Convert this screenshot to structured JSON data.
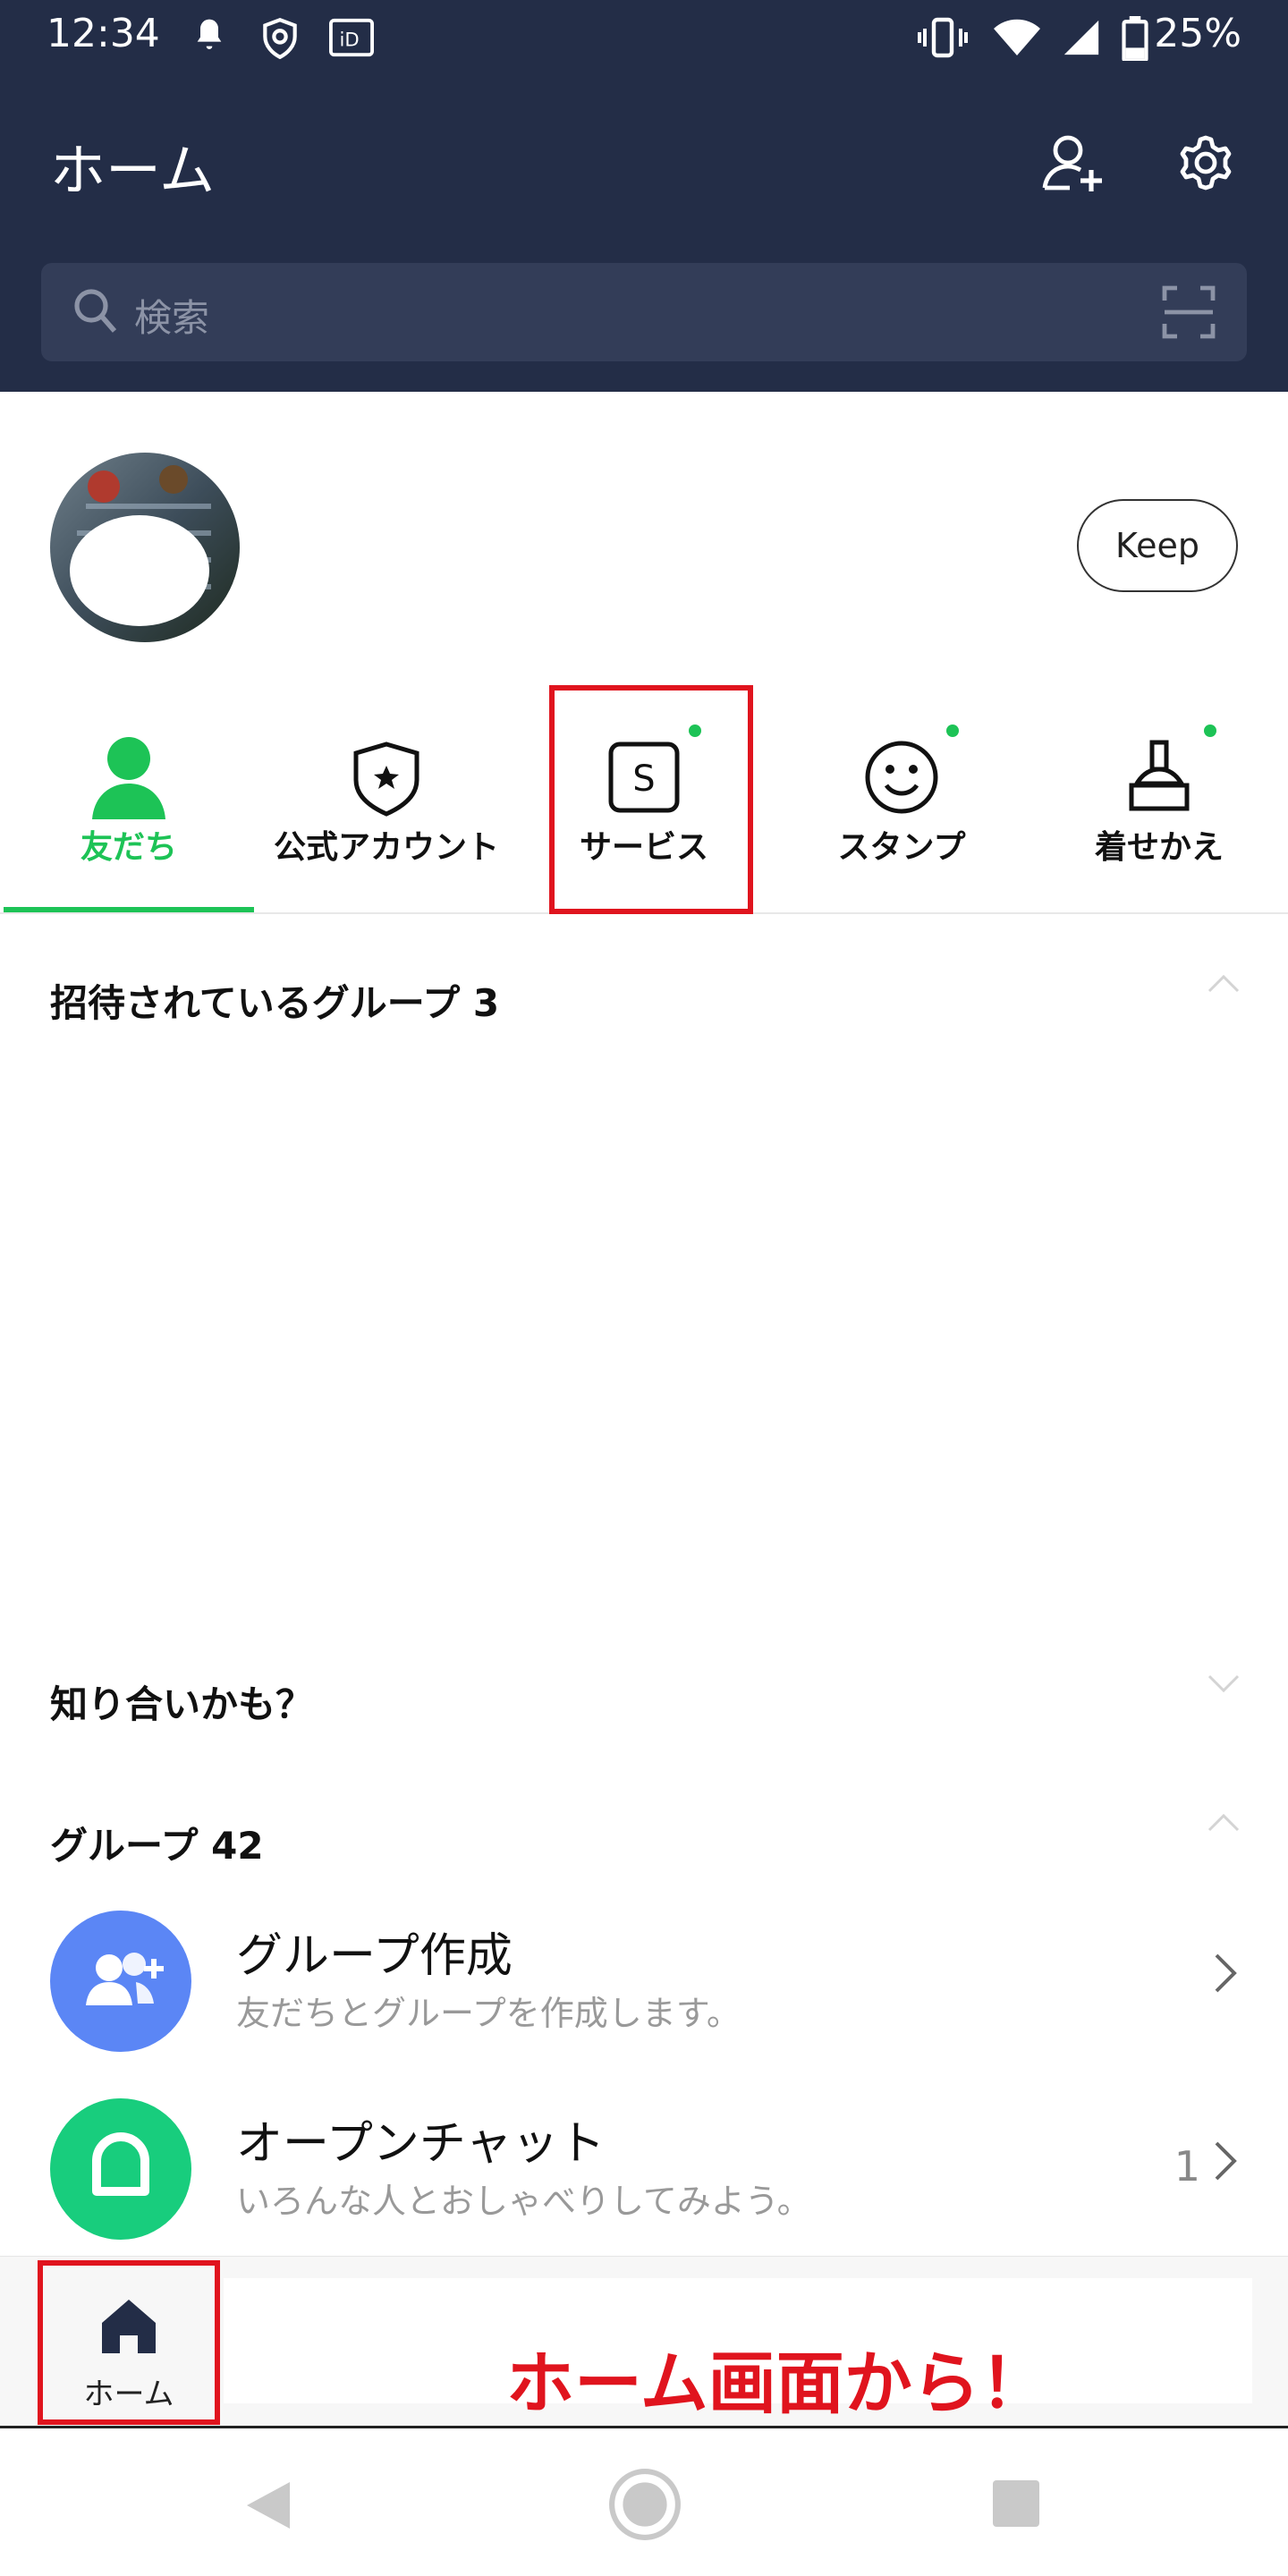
{
  "status_bar": {
    "time": "12:34",
    "battery": "25%"
  },
  "header": {
    "title": "ホーム"
  },
  "search": {
    "placeholder": "検索"
  },
  "profile": {
    "keep_label": "Keep"
  },
  "tabs": [
    {
      "label": "友だち",
      "icon": "person-icon",
      "active": true
    },
    {
      "label": "公式アカウント",
      "icon": "shield-star-icon"
    },
    {
      "label": "サービス",
      "icon": "service-s-icon",
      "badge": true
    },
    {
      "label": "スタンプ",
      "icon": "smiley-icon",
      "badge": true
    },
    {
      "label": "着せかえ",
      "icon": "brush-icon",
      "badge": true
    }
  ],
  "sections": {
    "invited": "招待されているグループ 3",
    "suggest": "知り合いかも？",
    "groups": "グループ 42"
  },
  "rows": [
    {
      "title": "グループ作成",
      "subtitle": "友だちとグループを作成します。",
      "color": "#5b86f5"
    },
    {
      "title": "オープンチャット",
      "subtitle": "いろんな人とおしゃべりしてみよう。",
      "count": "1",
      "color": "#18cd7d"
    }
  ],
  "bottom_nav": {
    "home_label": "ホーム",
    "annotation": "ホーム画面から！"
  },
  "colors": {
    "header_bg": "#232d47",
    "accent_green": "#1dc356",
    "highlight_red": "#e0141e"
  }
}
